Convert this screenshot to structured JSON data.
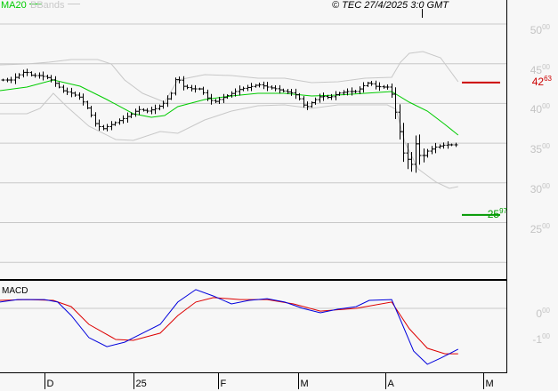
{
  "legend": {
    "ma_label": "MA20",
    "bb_label": "BBands",
    "ma_color": "#00cc00",
    "bb_color": "#c8c8c8"
  },
  "copyright": "© TEC 27/4/2025 3:0 GMT",
  "markers": {
    "resistance": {
      "int": "42",
      "dec": "63",
      "value": 42.63,
      "color": "#cc0000"
    },
    "support": {
      "int": "25",
      "dec": "97",
      "value": 25.97,
      "color": "#009900"
    }
  },
  "macd_label": "MACD",
  "chart_data": [
    {
      "type": "ohlc",
      "title": "",
      "y_ticks": [
        {
          "value": 50,
          "int": "50",
          "dec": "00"
        },
        {
          "value": 45,
          "int": "45",
          "dec": "00"
        },
        {
          "value": 40,
          "int": "40",
          "dec": "00"
        },
        {
          "value": 35,
          "int": "35",
          "dec": "00"
        },
        {
          "value": 30,
          "int": "30",
          "dec": "00"
        },
        {
          "value": 25,
          "int": "25",
          "dec": "00"
        }
      ],
      "gridlines": [
        50,
        45,
        40,
        35,
        30,
        25,
        20
      ],
      "ylim": [
        20,
        52
      ],
      "x_ticks": [
        {
          "t": 11.1,
          "label": "D"
        },
        {
          "t": 33.3,
          "label": "25"
        },
        {
          "t": 54.4,
          "label": "F"
        },
        {
          "t": 74.4,
          "label": "M"
        },
        {
          "t": 96.2,
          "label": "A"
        },
        {
          "t": 120.7,
          "label": "M"
        }
      ],
      "price": [
        [
          0.7,
          42.95
        ],
        [
          2.7,
          42.95
        ],
        [
          4.4,
          43.51
        ],
        [
          6.2,
          44.07
        ],
        [
          7.8,
          43.51
        ],
        [
          10,
          43.51
        ],
        [
          12.2,
          43.18
        ],
        [
          13.3,
          42.73
        ],
        [
          15.6,
          41.61
        ],
        [
          17.8,
          41.28
        ],
        [
          20,
          40.72
        ],
        [
          22.2,
          39.04
        ],
        [
          23.8,
          37.36
        ],
        [
          25.6,
          36.8
        ],
        [
          27.8,
          37.36
        ],
        [
          30,
          37.92
        ],
        [
          32.2,
          38.48
        ],
        [
          34.4,
          39.26
        ],
        [
          36.7,
          39.04
        ],
        [
          38.9,
          39.37
        ],
        [
          41.1,
          40.16
        ],
        [
          42.7,
          41.28
        ],
        [
          44,
          43.51
        ],
        [
          45.6,
          42.17
        ],
        [
          47.8,
          41.83
        ],
        [
          50,
          41.83
        ],
        [
          51.6,
          40.72
        ],
        [
          53.3,
          40.16
        ],
        [
          55.6,
          40.72
        ],
        [
          57.8,
          41.28
        ],
        [
          60,
          41.83
        ],
        [
          62.2,
          42.06
        ],
        [
          64.4,
          42.39
        ],
        [
          66.7,
          42.06
        ],
        [
          68.9,
          41.83
        ],
        [
          71.1,
          41.5
        ],
        [
          73.3,
          41.28
        ],
        [
          74.9,
          40.49
        ],
        [
          76.2,
          39.37
        ],
        [
          77.8,
          40.16
        ],
        [
          80,
          40.94
        ],
        [
          82.2,
          40.72
        ],
        [
          84.4,
          41.28
        ],
        [
          86.7,
          41.5
        ],
        [
          88.9,
          41.5
        ],
        [
          91.1,
          42.39
        ],
        [
          92.2,
          42.73
        ],
        [
          93.3,
          42.17
        ],
        [
          95.6,
          42.06
        ],
        [
          97.3,
          42.06
        ],
        [
          98.4,
          39.6
        ],
        [
          99.6,
          36.8
        ],
        [
          100.4,
          34.0
        ],
        [
          101.8,
          32.89
        ],
        [
          102.7,
          32.33
        ],
        [
          103.6,
          35.12
        ],
        [
          104.4,
          33.45
        ],
        [
          105.8,
          33.45
        ],
        [
          106.7,
          34.0
        ],
        [
          108.9,
          34.56
        ],
        [
          111.1,
          34.79
        ],
        [
          113.3,
          34.79
        ],
        [
          114.2,
          34.79
        ]
      ],
      "series": [
        {
          "name": "MA20",
          "color": "#00cc00",
          "values": [
            [
              0,
              41.61
            ],
            [
              6.7,
              42.06
            ],
            [
              13.3,
              42.95
            ],
            [
              20,
              42.17
            ],
            [
              26.7,
              40.49
            ],
            [
              33.3,
              38.7
            ],
            [
              37.8,
              38.26
            ],
            [
              41.1,
              38.48
            ],
            [
              44.4,
              39.6
            ],
            [
              51.1,
              40.49
            ],
            [
              57.8,
              40.94
            ],
            [
              64.4,
              41.28
            ],
            [
              71.1,
              41.28
            ],
            [
              77.8,
              40.94
            ],
            [
              84.4,
              41.05
            ],
            [
              91.1,
              41.28
            ],
            [
              97.8,
              41.5
            ],
            [
              102.2,
              40.16
            ],
            [
              106.7,
              39.04
            ],
            [
              111.1,
              37.36
            ],
            [
              114.4,
              36.02
            ]
          ]
        },
        {
          "name": "BB upper",
          "color": "#c8c8c8",
          "values": [
            [
              0,
              44.85
            ],
            [
              6.7,
              44.97
            ],
            [
              12.2,
              45.19
            ],
            [
              17.8,
              45.53
            ],
            [
              24.4,
              45.53
            ],
            [
              27.8,
              44.97
            ],
            [
              31.1,
              42.95
            ],
            [
              35.6,
              41.28
            ],
            [
              41.1,
              40.16
            ],
            [
              44.4,
              42.95
            ],
            [
              51.1,
              43.62
            ],
            [
              57.8,
              43.51
            ],
            [
              64.4,
              43.18
            ],
            [
              71.1,
              43.18
            ],
            [
              77.8,
              42.62
            ],
            [
              84.4,
              42.73
            ],
            [
              91.1,
              43.18
            ],
            [
              97.8,
              43.29
            ],
            [
              100,
              45.19
            ],
            [
              102.2,
              46.31
            ],
            [
              105.6,
              46.53
            ],
            [
              110,
              45.75
            ],
            [
              114.4,
              42.73
            ]
          ]
        },
        {
          "name": "BB lower",
          "color": "#c8c8c8",
          "values": [
            [
              0,
              38.7
            ],
            [
              6.7,
              38.7
            ],
            [
              10,
              39.37
            ],
            [
              13.3,
              41.28
            ],
            [
              16.7,
              39.6
            ],
            [
              22.2,
              37.14
            ],
            [
              28.9,
              35.46
            ],
            [
              33.3,
              35.35
            ],
            [
              40,
              36.47
            ],
            [
              44.4,
              36.24
            ],
            [
              51.1,
              37.92
            ],
            [
              57.8,
              39.04
            ],
            [
              64.4,
              39.71
            ],
            [
              71.1,
              39.82
            ],
            [
              77.8,
              39.37
            ],
            [
              84.4,
              39.82
            ],
            [
              91.1,
              39.82
            ],
            [
              96.7,
              39.82
            ],
            [
              98.9,
              39.26
            ],
            [
              101.1,
              35.12
            ],
            [
              104.4,
              31.77
            ],
            [
              108.9,
              30.09
            ],
            [
              112.2,
              29.31
            ],
            [
              114.4,
              29.53
            ]
          ]
        }
      ]
    },
    {
      "type": "line",
      "title": "MACD",
      "y_ticks": [
        {
          "value": 0,
          "int": "0",
          "dec": "00"
        },
        {
          "value": -1,
          "int": "-1",
          "dec": "00"
        }
      ],
      "gridlines": [
        0
      ],
      "series": [
        {
          "name": "MACD",
          "color": "#0000dd",
          "values": [
            [
              0,
              0.23
            ],
            [
              4.4,
              0.32
            ],
            [
              11.1,
              0.32
            ],
            [
              14.4,
              0.23
            ],
            [
              17.8,
              -0.26
            ],
            [
              22.2,
              -1.06
            ],
            [
              26.7,
              -1.39
            ],
            [
              31.1,
              -1.23
            ],
            [
              35.6,
              -0.9
            ],
            [
              40,
              -0.58
            ],
            [
              44.4,
              0.23
            ],
            [
              48.9,
              0.68
            ],
            [
              53.3,
              0.45
            ],
            [
              57.8,
              0.16
            ],
            [
              62.2,
              0.29
            ],
            [
              66.7,
              0.35
            ],
            [
              71.1,
              0.23
            ],
            [
              75.6,
              0
            ],
            [
              80,
              -0.16
            ],
            [
              84.4,
              -0.03
            ],
            [
              88.9,
              0.06
            ],
            [
              92.2,
              0.29
            ],
            [
              97.8,
              0.32
            ],
            [
              100,
              -0.42
            ],
            [
              103.3,
              -1.55
            ],
            [
              106.7,
              -2.03
            ],
            [
              110,
              -1.81
            ],
            [
              112.2,
              -1.65
            ],
            [
              114.4,
              -1.48
            ]
          ]
        },
        {
          "name": "Signal",
          "color": "#dd0000",
          "values": [
            [
              0,
              0.29
            ],
            [
              6.7,
              0.32
            ],
            [
              13.3,
              0.29
            ],
            [
              17.8,
              0.06
            ],
            [
              22.2,
              -0.58
            ],
            [
              28.9,
              -1.13
            ],
            [
              33.3,
              -1.16
            ],
            [
              40,
              -0.9
            ],
            [
              44.4,
              -0.26
            ],
            [
              48.9,
              0.23
            ],
            [
              53.3,
              0.39
            ],
            [
              60,
              0.32
            ],
            [
              66.7,
              0.32
            ],
            [
              73.3,
              0.16
            ],
            [
              80,
              -0.1
            ],
            [
              88.9,
              0
            ],
            [
              97.8,
              0.23
            ],
            [
              102.2,
              -0.74
            ],
            [
              106.7,
              -1.45
            ],
            [
              111.1,
              -1.65
            ],
            [
              114.4,
              -1.65
            ]
          ]
        }
      ]
    }
  ]
}
